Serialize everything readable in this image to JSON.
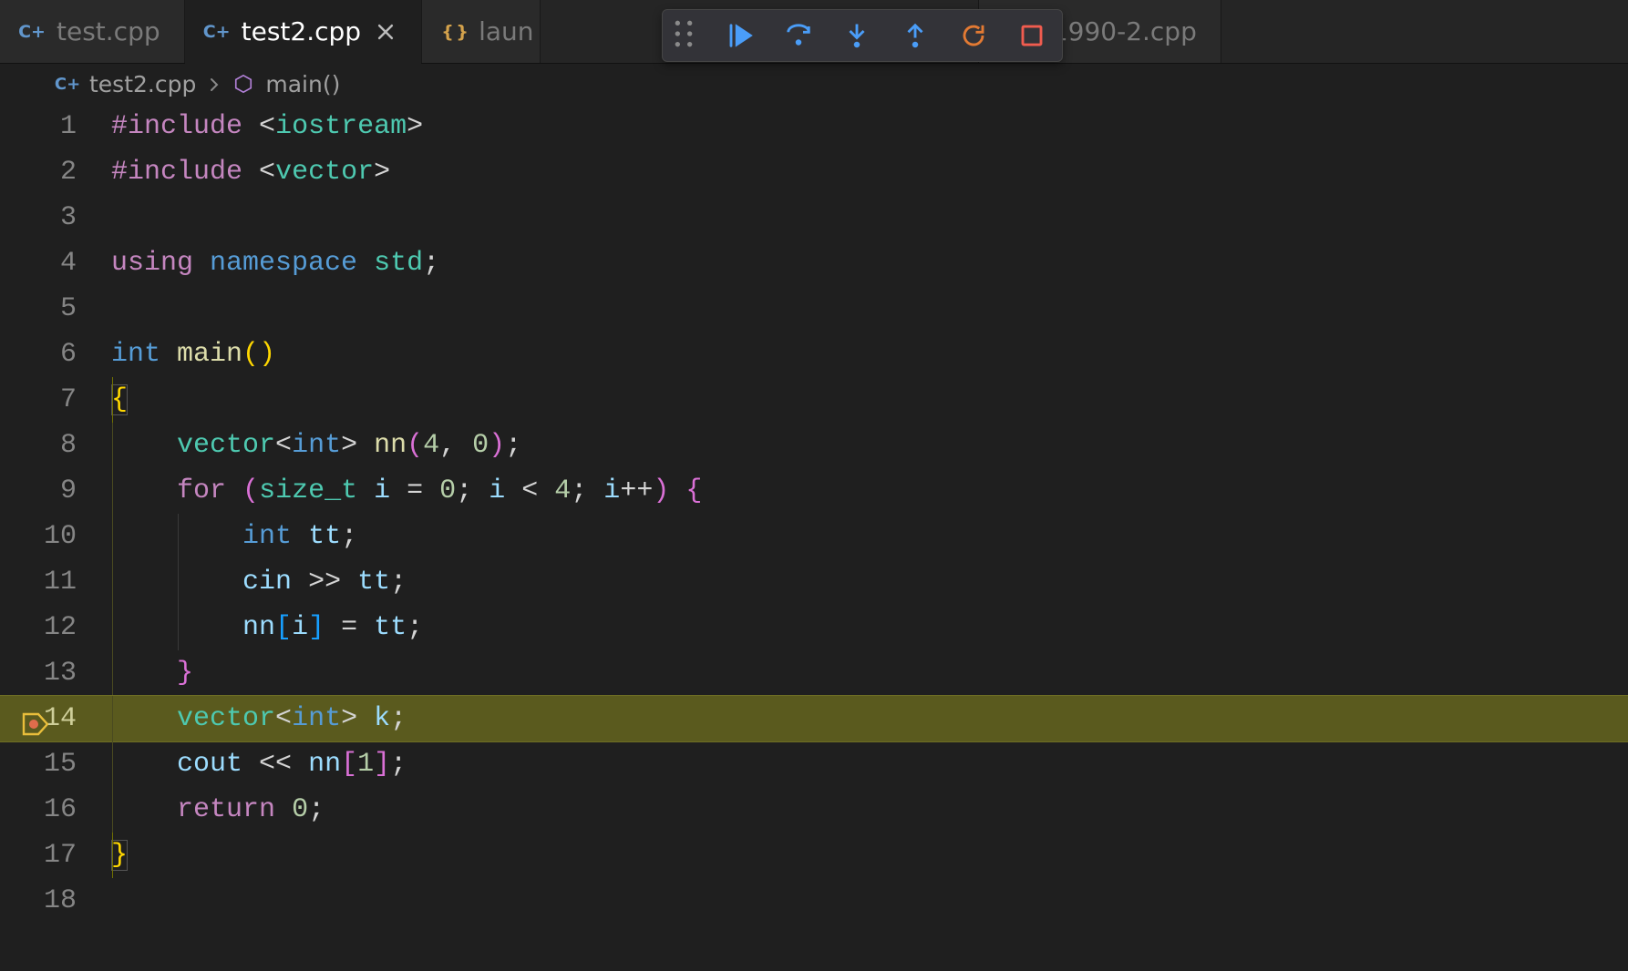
{
  "tabs": [
    {
      "label": "test.cpp",
      "icon": "cpp",
      "active": false,
      "close": false
    },
    {
      "label": "test2.cpp",
      "icon": "cpp",
      "active": true,
      "close": true
    },
    {
      "label": "laun",
      "icon": "json",
      "active": false,
      "close": false,
      "truncated": true
    },
    {
      "label": "p1990-2.cpp",
      "icon": "cpp",
      "active": false,
      "close": false,
      "offset": true
    }
  ],
  "debug_toolbar": {
    "buttons": [
      "grip",
      "continue",
      "step-over",
      "step-into",
      "step-out",
      "restart",
      "stop"
    ]
  },
  "breadcrumb": {
    "file": "test2.cpp",
    "symbol": "main()"
  },
  "breakpoint_line": 14,
  "highlight_line": 14,
  "code_lines": [
    {
      "n": 1,
      "tokens": [
        [
          "kw",
          "#include"
        ],
        [
          "pn",
          " "
        ],
        [
          "pn",
          "<"
        ],
        [
          "ty2",
          "iostream"
        ],
        [
          "pn",
          ">"
        ]
      ]
    },
    {
      "n": 2,
      "tokens": [
        [
          "kw",
          "#include"
        ],
        [
          "pn",
          " "
        ],
        [
          "pn",
          "<"
        ],
        [
          "ty2",
          "vector"
        ],
        [
          "pn",
          ">"
        ]
      ]
    },
    {
      "n": 3,
      "tokens": []
    },
    {
      "n": 4,
      "tokens": [
        [
          "kw",
          "using"
        ],
        [
          "pn",
          " "
        ],
        [
          "ty",
          "namespace"
        ],
        [
          "pn",
          " "
        ],
        [
          "ty2",
          "std"
        ],
        [
          "pn",
          ";"
        ]
      ]
    },
    {
      "n": 5,
      "tokens": []
    },
    {
      "n": 6,
      "tokens": [
        [
          "ty",
          "int"
        ],
        [
          "pn",
          " "
        ],
        [
          "fn",
          "main"
        ],
        [
          "b1",
          "("
        ],
        [
          "b1",
          ")"
        ]
      ]
    },
    {
      "n": 7,
      "tokens": [
        [
          "b1 bmatch",
          "{"
        ]
      ],
      "indent": 0
    },
    {
      "n": 8,
      "tokens": [
        [
          "pn",
          "    "
        ],
        [
          "ty2",
          "vector"
        ],
        [
          "pn",
          "<"
        ],
        [
          "ty",
          "int"
        ],
        [
          "pn",
          "> "
        ],
        [
          "fn",
          "nn"
        ],
        [
          "b2",
          "("
        ],
        [
          "nm",
          "4"
        ],
        [
          "pn",
          ", "
        ],
        [
          "nm",
          "0"
        ],
        [
          "b2",
          ")"
        ],
        [
          "pn",
          ";"
        ]
      ],
      "indent": 1
    },
    {
      "n": 9,
      "tokens": [
        [
          "pn",
          "    "
        ],
        [
          "kw",
          "for"
        ],
        [
          "pn",
          " "
        ],
        [
          "b2",
          "("
        ],
        [
          "ty2",
          "size_t"
        ],
        [
          "pn",
          " "
        ],
        [
          "vr",
          "i"
        ],
        [
          "pn",
          " "
        ],
        [
          "op",
          "="
        ],
        [
          "pn",
          " "
        ],
        [
          "nm",
          "0"
        ],
        [
          "pn",
          "; "
        ],
        [
          "vr",
          "i"
        ],
        [
          "pn",
          " "
        ],
        [
          "op",
          "<"
        ],
        [
          "pn",
          " "
        ],
        [
          "nm",
          "4"
        ],
        [
          "pn",
          "; "
        ],
        [
          "vr",
          "i"
        ],
        [
          "op",
          "++"
        ],
        [
          "b2",
          ")"
        ],
        [
          "pn",
          " "
        ],
        [
          "b2",
          "{"
        ]
      ],
      "indent": 1
    },
    {
      "n": 10,
      "tokens": [
        [
          "pn",
          "        "
        ],
        [
          "ty",
          "int"
        ],
        [
          "pn",
          " "
        ],
        [
          "vr",
          "tt"
        ],
        [
          "pn",
          ";"
        ]
      ],
      "indent": 2
    },
    {
      "n": 11,
      "tokens": [
        [
          "pn",
          "        "
        ],
        [
          "vr",
          "cin"
        ],
        [
          "pn",
          " "
        ],
        [
          "op",
          ">>"
        ],
        [
          "pn",
          " "
        ],
        [
          "vr",
          "tt"
        ],
        [
          "pn",
          ";"
        ]
      ],
      "indent": 2
    },
    {
      "n": 12,
      "tokens": [
        [
          "pn",
          "        "
        ],
        [
          "vr",
          "nn"
        ],
        [
          "b3",
          "["
        ],
        [
          "vr",
          "i"
        ],
        [
          "b3",
          "]"
        ],
        [
          "pn",
          " "
        ],
        [
          "op",
          "="
        ],
        [
          "pn",
          " "
        ],
        [
          "vr",
          "tt"
        ],
        [
          "pn",
          ";"
        ]
      ],
      "indent": 2
    },
    {
      "n": 13,
      "tokens": [
        [
          "pn",
          "    "
        ],
        [
          "b2",
          "}"
        ]
      ],
      "indent": 1
    },
    {
      "n": 14,
      "tokens": [
        [
          "pn",
          "    "
        ],
        [
          "ty2",
          "vector"
        ],
        [
          "pn",
          "<"
        ],
        [
          "ty",
          "int"
        ],
        [
          "pn",
          "> "
        ],
        [
          "vr",
          "k"
        ],
        [
          "pn",
          ";"
        ]
      ],
      "indent": 1
    },
    {
      "n": 15,
      "tokens": [
        [
          "pn",
          "    "
        ],
        [
          "vr",
          "cout"
        ],
        [
          "pn",
          " "
        ],
        [
          "op",
          "<<"
        ],
        [
          "pn",
          " "
        ],
        [
          "vr",
          "nn"
        ],
        [
          "b2",
          "["
        ],
        [
          "nm",
          "1"
        ],
        [
          "b2",
          "]"
        ],
        [
          "pn",
          ";"
        ]
      ],
      "indent": 1
    },
    {
      "n": 16,
      "tokens": [
        [
          "pn",
          "    "
        ],
        [
          "kw",
          "return"
        ],
        [
          "pn",
          " "
        ],
        [
          "nm",
          "0"
        ],
        [
          "pn",
          ";"
        ]
      ],
      "indent": 1
    },
    {
      "n": 17,
      "tokens": [
        [
          "b1 bmatch",
          "}"
        ]
      ],
      "indent": 0
    },
    {
      "n": 18,
      "tokens": []
    }
  ],
  "icons": {
    "cpp": "C+",
    "json": "{ }"
  }
}
